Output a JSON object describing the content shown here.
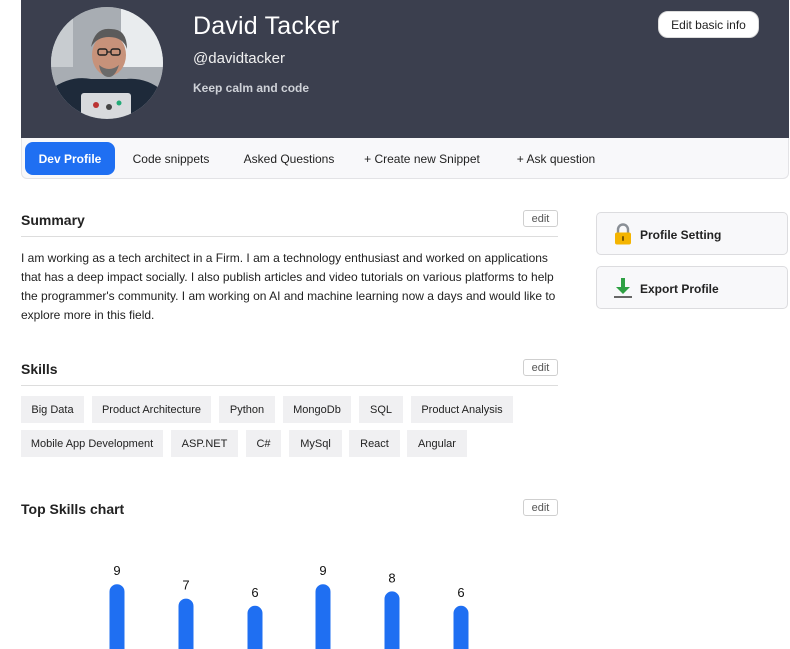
{
  "profile": {
    "name": "David Tacker",
    "handle": "@davidtacker",
    "tagline": "Keep calm and code",
    "edit_basic_label": "Edit basic info"
  },
  "tabs": [
    {
      "label": "Dev Profile",
      "active": true
    },
    {
      "label": "Code snippets",
      "active": false
    },
    {
      "label": "Asked Questions",
      "active": false
    },
    {
      "label": "+ Create new Snippet",
      "active": false
    },
    {
      "label": "+ Ask question",
      "active": false
    }
  ],
  "summary": {
    "title": "Summary",
    "edit_label": "edit",
    "text": "I am working as a tech architect in a Firm. I am a technology enthusiast and worked on applications that has a deep impact socially. I also publish articles and video tutorials on various platforms to help the programmer's community. I am working on AI and machine learning now a days and would like to explore more in this field."
  },
  "skills": {
    "title": "Skills",
    "edit_label": "edit",
    "items": [
      "Big Data",
      "Product Architecture",
      "Python",
      "MongoDb",
      "SQL",
      "Product Analysis",
      "Mobile App Development",
      "ASP.NET",
      "C#",
      "MySql",
      "React",
      "Angular"
    ]
  },
  "top_skills": {
    "title": "Top Skills chart",
    "edit_label": "edit"
  },
  "side": {
    "profile_setting_label": "Profile Setting",
    "profile_setting_icon": "lock-icon",
    "export_profile_label": "Export Profile",
    "export_profile_icon": "download-icon"
  },
  "colors": {
    "header_bg": "#3b3f4e",
    "accent": "#1f6ff2"
  },
  "chart_data": {
    "type": "bar",
    "values": [
      9,
      7,
      6,
      9,
      8,
      6
    ]
  }
}
